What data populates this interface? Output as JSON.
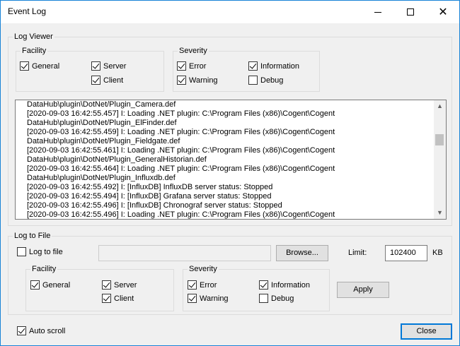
{
  "window": {
    "title": "Event Log",
    "controls": {
      "minimize": "minimize",
      "maximize": "maximize",
      "close": "✕"
    }
  },
  "log_viewer": {
    "group_label": "Log Viewer",
    "facility": {
      "label": "Facility",
      "general": "General",
      "server": "Server",
      "client": "Client"
    },
    "severity": {
      "label": "Severity",
      "error": "Error",
      "information": "Information",
      "warning": "Warning",
      "debug": "Debug"
    },
    "lines": [
      "DataHub\\plugin\\DotNet/Plugin_Camera.def",
      "[2020-09-03 16:42:55.457] I: Loading .NET plugin: C:\\Program Files (x86)\\Cogent\\Cogent",
      "DataHub\\plugin\\DotNet/Plugin_ElFinder.def",
      "[2020-09-03 16:42:55.459] I: Loading .NET plugin: C:\\Program Files (x86)\\Cogent\\Cogent",
      "DataHub\\plugin\\DotNet/Plugin_Fieldgate.def",
      "[2020-09-03 16:42:55.461] I: Loading .NET plugin: C:\\Program Files (x86)\\Cogent\\Cogent",
      "DataHub\\plugin\\DotNet/Plugin_GeneralHistorian.def",
      "[2020-09-03 16:42:55.464] I: Loading .NET plugin: C:\\Program Files (x86)\\Cogent\\Cogent",
      "DataHub\\plugin\\DotNet/Plugin_Influxdb.def",
      "[2020-09-03 16:42:55.492] I: [InfluxDB] InfluxDB server status: Stopped",
      "[2020-09-03 16:42:55.494] I: [InfluxDB] Grafana server status: Stopped",
      "[2020-09-03 16:42:55.496] I: [InfluxDB] Chronograf server status: Stopped",
      "[2020-09-03 16:42:55.496] I: Loading .NET plugin: C:\\Program Files (x86)\\Cogent\\Cogent"
    ]
  },
  "log_to_file": {
    "group_label": "Log to File",
    "log_to_file_label": "Log to file",
    "file_path": "",
    "browse_label": "Browse...",
    "limit_label": "Limit:",
    "limit_value": "102400",
    "limit_unit": "KB",
    "facility": {
      "label": "Facility",
      "general": "General",
      "server": "Server",
      "client": "Client"
    },
    "severity": {
      "label": "Severity",
      "error": "Error",
      "information": "Information",
      "warning": "Warning",
      "debug": "Debug"
    },
    "apply_label": "Apply"
  },
  "footer": {
    "auto_scroll_label": "Auto scroll",
    "close_label": "Close"
  }
}
